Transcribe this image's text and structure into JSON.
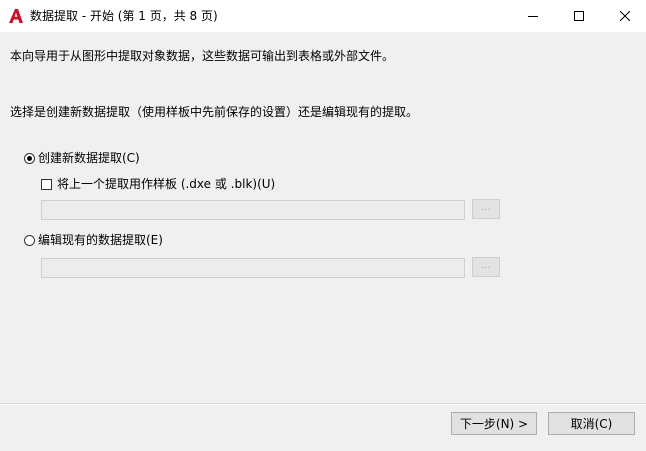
{
  "window": {
    "title": "数据提取 - 开始 (第 1 页，共 8 页)",
    "icons": {
      "app": "autocad-logo-icon",
      "minimize": "minimize-icon",
      "maximize": "maximize-icon",
      "close": "close-icon"
    },
    "brand_color": "#c8102e"
  },
  "content": {
    "intro": "本向导用于从图形中提取对象数据，这些数据可输出到表格或外部文件。",
    "question": "选择是创建新数据提取（使用样板中先前保存的设置）还是编辑现有的提取。",
    "option_create": {
      "label": "创建新数据提取(C)",
      "selected": true
    },
    "use_template": {
      "label": "将上一个提取用作样板 (.dxe 或 .blk)(U)",
      "checked": false
    },
    "create_path": {
      "value": "",
      "browse_label": "..."
    },
    "option_edit": {
      "label": "编辑现有的数据提取(E)",
      "selected": false
    },
    "edit_path": {
      "value": "",
      "browse_label": "..."
    }
  },
  "footer": {
    "next_label": "下一步(N) >",
    "cancel_label": "取消(C)"
  }
}
